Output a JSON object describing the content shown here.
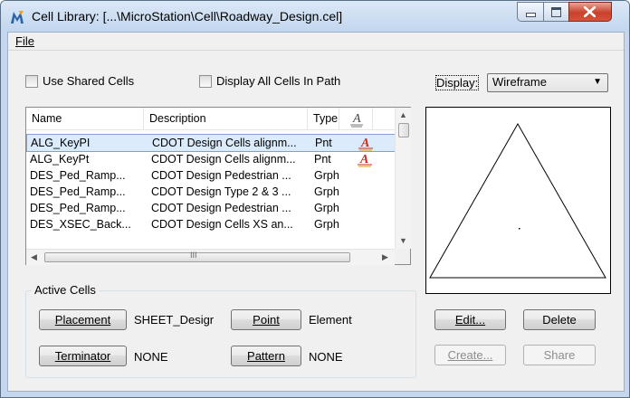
{
  "window": {
    "title": "Cell Library: [...\\MicroStation\\Cell\\Roadway_Design.cel]",
    "app_icon": "microstation-icon",
    "colors": {
      "titlebar": "#c2d6ee",
      "close_button": "#c9422c",
      "selection": "#dcebfc"
    }
  },
  "menu": {
    "file_label": "File"
  },
  "options": {
    "use_shared_cells_label": "Use Shared Cells",
    "use_shared_cells_checked": false,
    "display_all_cells_label": "Display All Cells In Path",
    "display_all_cells_checked": false
  },
  "display": {
    "label": "Display:",
    "selected": "Wireframe"
  },
  "cell_list": {
    "columns": [
      "Name",
      "Description",
      "Type"
    ],
    "rows": [
      {
        "name": "ALG_KeyPI",
        "description": "CDOT Design Cells alignm...",
        "type": "Pnt",
        "icon": "point-cell-icon",
        "selected": true
      },
      {
        "name": "ALG_KeyPt",
        "description": "CDOT Design Cells alignm...",
        "type": "Pnt",
        "icon": "point-cell-icon",
        "selected": false
      },
      {
        "name": "DES_Ped_Ramp...",
        "description": "CDOT Design Pedestrian ...",
        "type": "Grph",
        "icon": "",
        "selected": false
      },
      {
        "name": "DES_Ped_Ramp...",
        "description": "CDOT Design Type 2 & 3 ...",
        "type": "Grph",
        "icon": "",
        "selected": false
      },
      {
        "name": "DES_Ped_Ramp...",
        "description": "CDOT Design Pedestrian ...",
        "type": "Grph",
        "icon": "",
        "selected": false
      },
      {
        "name": "DES_XSEC_Back...",
        "description": "CDOT Design Cells XS an...",
        "type": "Grph",
        "icon": "",
        "selected": false
      }
    ],
    "hscroll_thumb_glyph": "III"
  },
  "active_cells": {
    "group_label": "Active Cells",
    "placement_button": "Placement",
    "placement_value": "SHEET_Desigr",
    "point_button": "Point",
    "point_value": "Element",
    "terminator_button": "Terminator",
    "terminator_value": "NONE",
    "pattern_button": "Pattern",
    "pattern_value": "NONE"
  },
  "actions": {
    "edit_button": "Edit...",
    "delete_button": "Delete",
    "create_button": "Create...",
    "share_button": "Share"
  }
}
